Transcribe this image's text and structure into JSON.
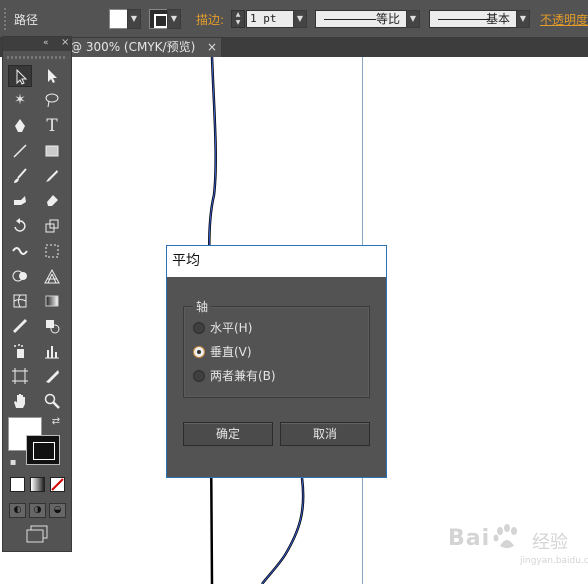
{
  "control_bar": {
    "object_type": "路径",
    "stroke_label": "描边:",
    "stroke_weight": "1 pt",
    "profile_label": "等比",
    "brush_label": "基本",
    "opacity_label": "不透明度"
  },
  "document": {
    "tab_title": "@ 300% (CMYK/预览)",
    "close_symbol": "×"
  },
  "tools_panel": {
    "collapse_symbol": "«",
    "close_symbol": "×"
  },
  "dialog": {
    "title": "平均",
    "group_label": "轴",
    "options": [
      {
        "label": "水平(H)",
        "selected": false
      },
      {
        "label": "垂直(V)",
        "selected": true
      },
      {
        "label": "两者兼有(B)",
        "selected": false
      }
    ],
    "ok_label": "确定",
    "cancel_label": "取消"
  },
  "watermark": {
    "brand_left": "Bai",
    "brand_right": "经验",
    "sub": "jingyan.baidu.com"
  },
  "colors": {
    "panel_bg": "#535353",
    "accent_orange": "#e49c2a",
    "dialog_border": "#2a73b8",
    "path_blue": "#3a5fd0"
  }
}
